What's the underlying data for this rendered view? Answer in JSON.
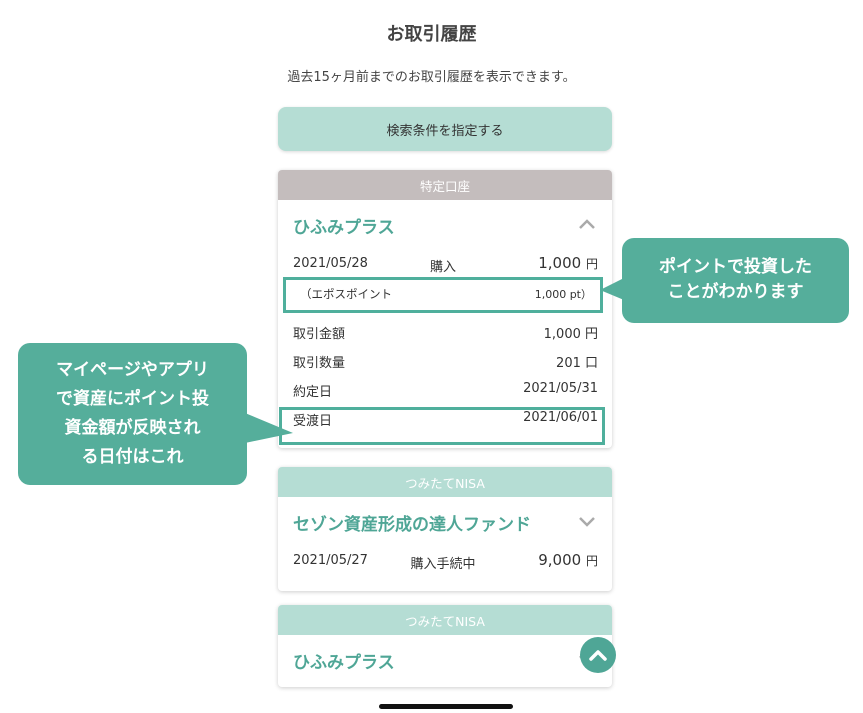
{
  "page": {
    "title": "お取引履歴",
    "subtitle": "過去15ヶ月前までのお取引履歴を表示できます。",
    "search_button": "検索条件を指定する"
  },
  "cards": [
    {
      "account": "特定口座",
      "fund": "ひふみプラス",
      "date": "2021/05/28",
      "type": "購入",
      "amount": "1,000",
      "unit": "円",
      "point_label": "（エポスポイント",
      "point_value": "1,000 pt）",
      "details": [
        {
          "label": "取引金額",
          "value": "1,000 円"
        },
        {
          "label": "取引数量",
          "value": "201 口"
        },
        {
          "label": "約定日",
          "value": "2021/05/31"
        },
        {
          "label": "受渡日",
          "value": "2021/06/01"
        }
      ]
    },
    {
      "account": "つみたてNISA",
      "fund": "セゾン資産形成の達人ファンド",
      "date": "2021/05/27",
      "type": "購入手続中",
      "amount": "9,000",
      "unit": "円"
    },
    {
      "account": "つみたてNISA",
      "fund": "ひふみプラス"
    }
  ],
  "callouts": {
    "right_line1": "ポイントで投資した",
    "right_line2": "ことがわかります",
    "left_line1": "マイページやアプリ",
    "left_line2": "で資産にポイント投",
    "left_line3": "資金額が反映され",
    "left_line4": "る日付はこれ"
  },
  "colors": {
    "accent": "#4fa696",
    "header_gray": "#c4bdbd",
    "header_green": "#b5ddd4",
    "callout": "#55ae9b"
  },
  "icons": [
    "chevron-up-icon",
    "chevron-down-icon",
    "scroll-to-top-icon"
  ]
}
